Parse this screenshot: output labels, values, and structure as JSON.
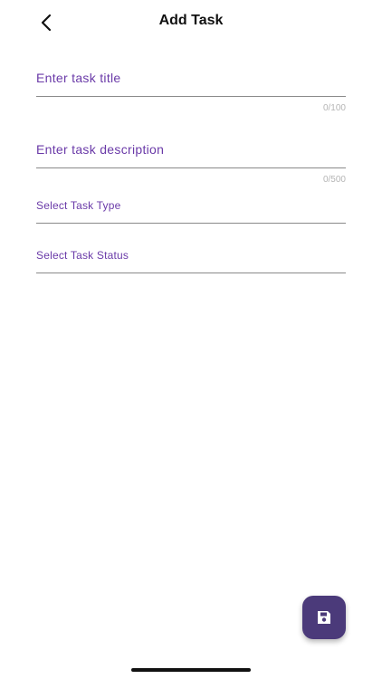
{
  "header": {
    "title": "Add Task",
    "back_icon": "chevron-left-icon"
  },
  "form": {
    "title_field": {
      "placeholder": "Enter task title",
      "value": "",
      "counter": "0/100"
    },
    "description_field": {
      "placeholder": "Enter task description",
      "value": "",
      "counter": "0/500"
    },
    "type_select": {
      "label": "Select Task Type"
    },
    "status_select": {
      "label": "Select Task Status"
    }
  },
  "fab": {
    "icon": "save-icon"
  },
  "colors": {
    "accent_text": "#6a3aa8",
    "fab_background": "#4b3a7a",
    "counter_text": "#b5b5b5"
  }
}
